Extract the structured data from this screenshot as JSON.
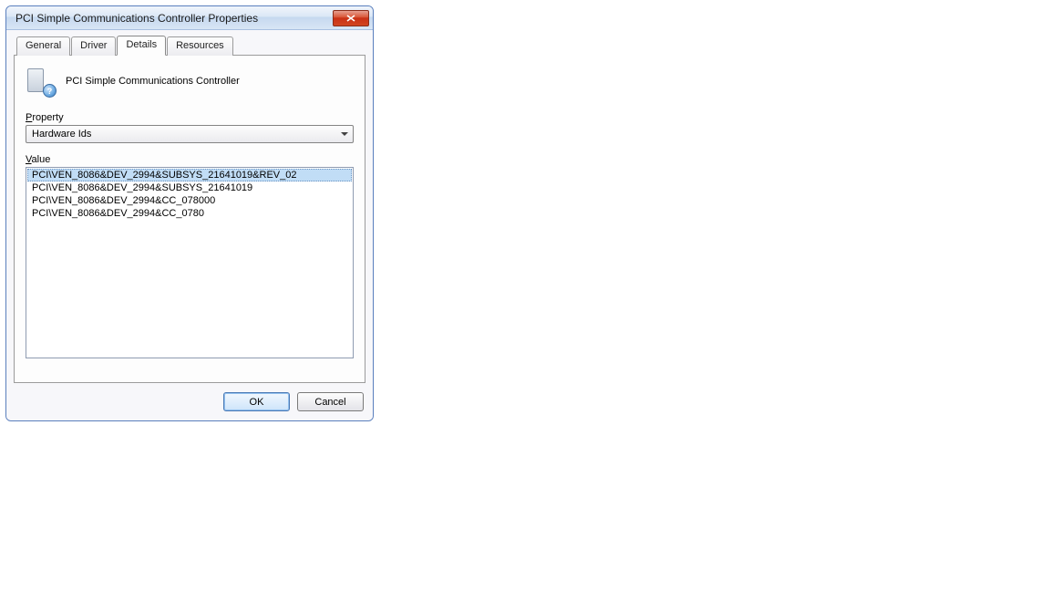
{
  "window": {
    "title": "PCI Simple Communications Controller Properties"
  },
  "tabs": [
    {
      "label": "General"
    },
    {
      "label": "Driver"
    },
    {
      "label": "Details"
    },
    {
      "label": "Resources"
    }
  ],
  "device": {
    "name": "PCI Simple Communications Controller"
  },
  "property": {
    "label_prefix": "P",
    "label_rest": "roperty",
    "selected": "Hardware Ids"
  },
  "value": {
    "label_prefix": "V",
    "label_rest": "alue",
    "items": [
      "PCI\\VEN_8086&DEV_2994&SUBSYS_21641019&REV_02",
      "PCI\\VEN_8086&DEV_2994&SUBSYS_21641019",
      "PCI\\VEN_8086&DEV_2994&CC_078000",
      "PCI\\VEN_8086&DEV_2994&CC_0780"
    ]
  },
  "buttons": {
    "ok": "OK",
    "cancel": "Cancel"
  }
}
